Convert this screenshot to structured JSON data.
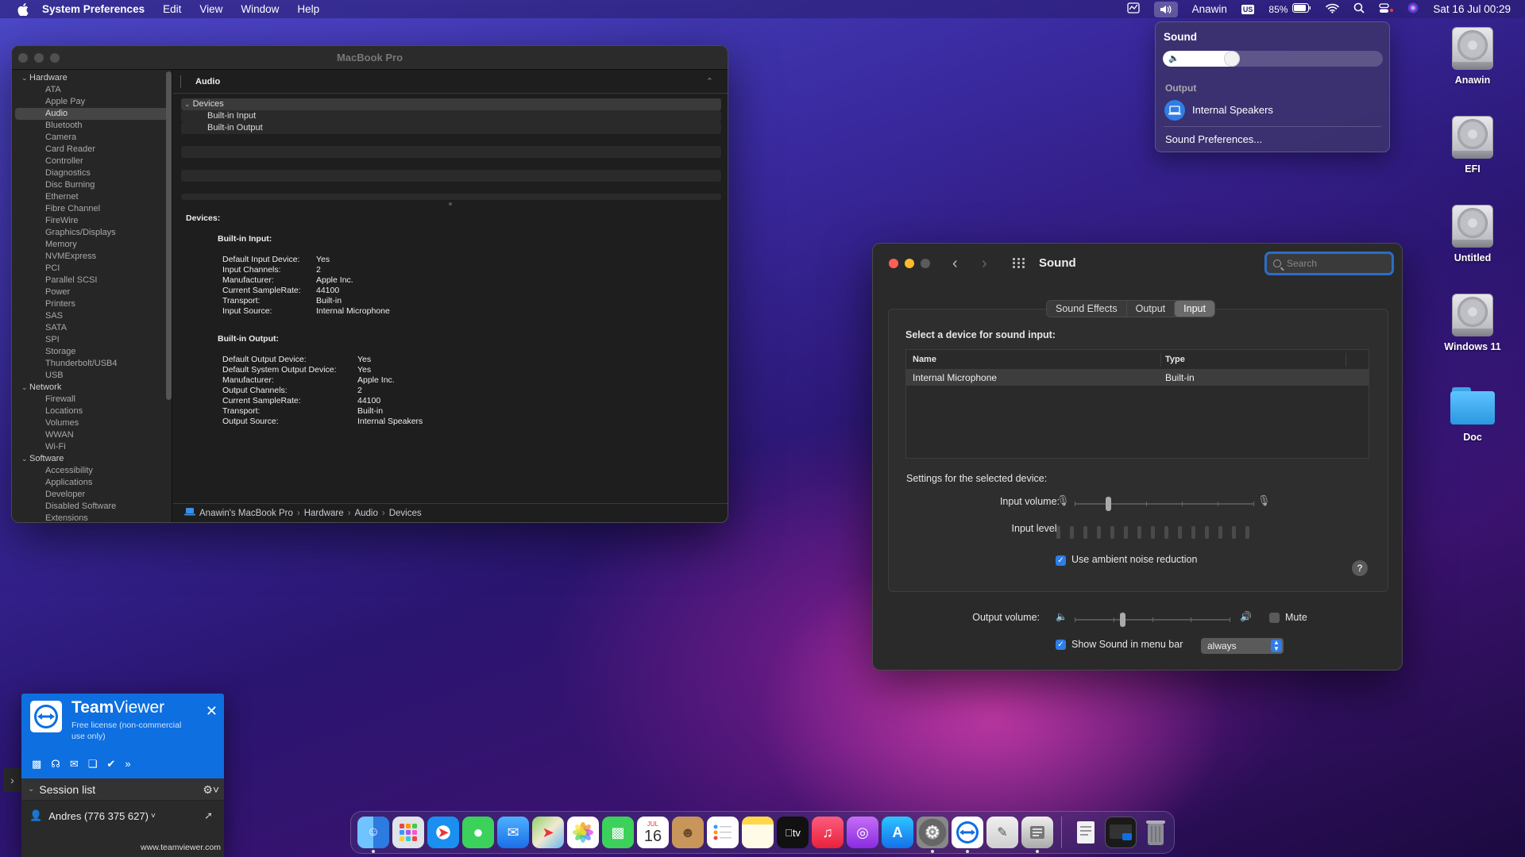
{
  "menubar": {
    "app_name": "System Preferences",
    "menus": [
      "Edit",
      "View",
      "Window",
      "Help"
    ],
    "user": "Anawin",
    "input_source": "US",
    "battery": "85%",
    "datetime": "Sat 16 Jul  00:29",
    "icons": [
      "apple-icon",
      "activity-monitor-icon",
      "volume-icon",
      "keyboard-input-icon",
      "battery-icon",
      "wifi-icon",
      "spotlight-icon",
      "control-center-icon",
      "siri-icon"
    ]
  },
  "sound_menu": {
    "title": "Sound",
    "volume_fraction": 0.3,
    "output_label": "Output",
    "device": "Internal Speakers",
    "prefs_link": "Sound Preferences..."
  },
  "sysinfo": {
    "title": "MacBook Pro",
    "sidebar": [
      {
        "group": "Hardware",
        "items": [
          "ATA",
          "Apple Pay",
          "Audio",
          "Bluetooth",
          "Camera",
          "Card Reader",
          "Controller",
          "Diagnostics",
          "Disc Burning",
          "Ethernet",
          "Fibre Channel",
          "FireWire",
          "Graphics/Displays",
          "Memory",
          "NVMExpress",
          "PCI",
          "Parallel SCSI",
          "Power",
          "Printers",
          "SAS",
          "SATA",
          "SPI",
          "Storage",
          "Thunderbolt/USB4",
          "USB"
        ]
      },
      {
        "group": "Network",
        "items": [
          "Firewall",
          "Locations",
          "Volumes",
          "WWAN",
          "Wi-Fi"
        ]
      },
      {
        "group": "Software",
        "items": [
          "Accessibility",
          "Applications",
          "Developer",
          "Disabled Software",
          "Extensions"
        ]
      }
    ],
    "selected": "Audio",
    "header": "Audio",
    "tree": {
      "head": "Devices",
      "children": [
        "Built-in Input",
        "Built-in Output"
      ]
    },
    "detail": {
      "heading": "Devices:",
      "input": {
        "title": "Built-in Input:",
        "rows": [
          [
            "Default Input Device:",
            "Yes"
          ],
          [
            "Input Channels:",
            "2"
          ],
          [
            "Manufacturer:",
            "Apple Inc."
          ],
          [
            "Current SampleRate:",
            "44100"
          ],
          [
            "Transport:",
            "Built-in"
          ],
          [
            "Input Source:",
            "Internal Microphone"
          ]
        ]
      },
      "output": {
        "title": "Built-in Output:",
        "rows": [
          [
            "Default Output Device:",
            "Yes"
          ],
          [
            "Default System Output Device:",
            "Yes"
          ],
          [
            "Manufacturer:",
            "Apple Inc."
          ],
          [
            "Output Channels:",
            "2"
          ],
          [
            "Current SampleRate:",
            "44100"
          ],
          [
            "Transport:",
            "Built-in"
          ],
          [
            "Output Source:",
            "Internal Speakers"
          ]
        ]
      }
    },
    "path": [
      "Anawin's MacBook Pro",
      "Hardware",
      "Audio",
      "Devices"
    ]
  },
  "sound": {
    "title": "Sound",
    "search_placeholder": "Search",
    "tabs": [
      "Sound Effects",
      "Output",
      "Input"
    ],
    "active_tab": "Input",
    "select_label": "Select a device for sound input:",
    "columns": [
      "Name",
      "Type"
    ],
    "devices": [
      {
        "name": "Internal Microphone",
        "type": "Built-in"
      }
    ],
    "settings_label": "Settings for the selected device:",
    "input_volume_label": "Input volume:",
    "input_volume": 0.18,
    "input_level_label": "Input level:",
    "input_level": 0,
    "noise_label": "Use ambient noise reduction",
    "noise_checked": true,
    "output_volume_label": "Output volume:",
    "output_volume": 0.3,
    "mute_label": "Mute",
    "mute_checked": false,
    "show_label": "Show Sound in menu bar",
    "show_checked": true,
    "show_option": "always"
  },
  "desktop": {
    "icons": [
      {
        "name": "Anawin",
        "kind": "disk"
      },
      {
        "name": "EFI",
        "kind": "disk"
      },
      {
        "name": "Untitled",
        "kind": "disk"
      },
      {
        "name": "Windows 11",
        "kind": "disk"
      },
      {
        "name": "Doc",
        "kind": "folder"
      }
    ]
  },
  "teamviewer": {
    "name_bold": "Team",
    "name_rest": "Viewer",
    "license": "Free license (non-commercial use only)",
    "session_list": "Session list",
    "user": "Andres (776 375 627)",
    "url": "www.teamviewer.com"
  },
  "dock": {
    "calendar_month": "JUL",
    "calendar_day": "16",
    "items": [
      "finder",
      "launchpad",
      "safari",
      "messages",
      "mail",
      "maps",
      "photos",
      "facetime",
      "calendar",
      "contacts",
      "reminders",
      "notes",
      "tv",
      "music",
      "podcasts",
      "app-store",
      "system-preferences",
      "teamviewer",
      "script-editor",
      "system-information",
      "documents",
      "screen-sharing",
      "trash"
    ]
  }
}
